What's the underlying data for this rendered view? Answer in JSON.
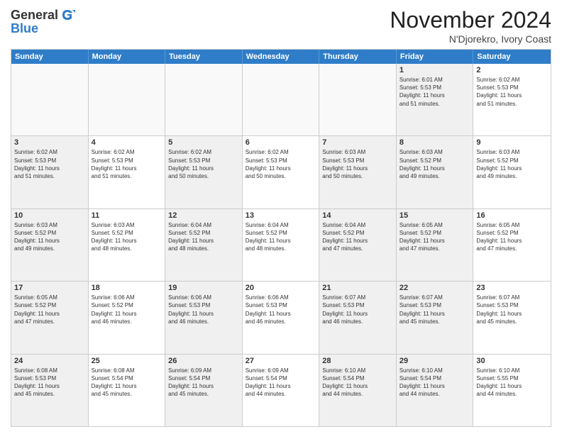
{
  "header": {
    "logo_line1": "General",
    "logo_line2": "Blue",
    "month_title": "November 2024",
    "location": "N'Djorekro, Ivory Coast"
  },
  "weekdays": [
    "Sunday",
    "Monday",
    "Tuesday",
    "Wednesday",
    "Thursday",
    "Friday",
    "Saturday"
  ],
  "rows": [
    [
      {
        "day": "",
        "info": "",
        "empty": true
      },
      {
        "day": "",
        "info": "",
        "empty": true
      },
      {
        "day": "",
        "info": "",
        "empty": true
      },
      {
        "day": "",
        "info": "",
        "empty": true
      },
      {
        "day": "",
        "info": "",
        "empty": true
      },
      {
        "day": "1",
        "info": "Sunrise: 6:01 AM\nSunset: 5:53 PM\nDaylight: 11 hours\nand 51 minutes.",
        "shaded": true
      },
      {
        "day": "2",
        "info": "Sunrise: 6:02 AM\nSunset: 5:53 PM\nDaylight: 11 hours\nand 51 minutes.",
        "shaded": false
      }
    ],
    [
      {
        "day": "3",
        "info": "Sunrise: 6:02 AM\nSunset: 5:53 PM\nDaylight: 11 hours\nand 51 minutes.",
        "shaded": true
      },
      {
        "day": "4",
        "info": "Sunrise: 6:02 AM\nSunset: 5:53 PM\nDaylight: 11 hours\nand 51 minutes."
      },
      {
        "day": "5",
        "info": "Sunrise: 6:02 AM\nSunset: 5:53 PM\nDaylight: 11 hours\nand 50 minutes.",
        "shaded": true
      },
      {
        "day": "6",
        "info": "Sunrise: 6:02 AM\nSunset: 5:53 PM\nDaylight: 11 hours\nand 50 minutes."
      },
      {
        "day": "7",
        "info": "Sunrise: 6:03 AM\nSunset: 5:53 PM\nDaylight: 11 hours\nand 50 minutes.",
        "shaded": true
      },
      {
        "day": "8",
        "info": "Sunrise: 6:03 AM\nSunset: 5:52 PM\nDaylight: 11 hours\nand 49 minutes.",
        "shaded": true
      },
      {
        "day": "9",
        "info": "Sunrise: 6:03 AM\nSunset: 5:52 PM\nDaylight: 11 hours\nand 49 minutes."
      }
    ],
    [
      {
        "day": "10",
        "info": "Sunrise: 6:03 AM\nSunset: 5:52 PM\nDaylight: 11 hours\nand 49 minutes.",
        "shaded": true
      },
      {
        "day": "11",
        "info": "Sunrise: 6:03 AM\nSunset: 5:52 PM\nDaylight: 11 hours\nand 48 minutes."
      },
      {
        "day": "12",
        "info": "Sunrise: 6:04 AM\nSunset: 5:52 PM\nDaylight: 11 hours\nand 48 minutes.",
        "shaded": true
      },
      {
        "day": "13",
        "info": "Sunrise: 6:04 AM\nSunset: 5:52 PM\nDaylight: 11 hours\nand 48 minutes."
      },
      {
        "day": "14",
        "info": "Sunrise: 6:04 AM\nSunset: 5:52 PM\nDaylight: 11 hours\nand 47 minutes.",
        "shaded": true
      },
      {
        "day": "15",
        "info": "Sunrise: 6:05 AM\nSunset: 5:52 PM\nDaylight: 11 hours\nand 47 minutes.",
        "shaded": true
      },
      {
        "day": "16",
        "info": "Sunrise: 6:05 AM\nSunset: 5:52 PM\nDaylight: 11 hours\nand 47 minutes."
      }
    ],
    [
      {
        "day": "17",
        "info": "Sunrise: 6:05 AM\nSunset: 5:52 PM\nDaylight: 11 hours\nand 47 minutes.",
        "shaded": true
      },
      {
        "day": "18",
        "info": "Sunrise: 6:06 AM\nSunset: 5:52 PM\nDaylight: 11 hours\nand 46 minutes."
      },
      {
        "day": "19",
        "info": "Sunrise: 6:06 AM\nSunset: 5:53 PM\nDaylight: 11 hours\nand 46 minutes.",
        "shaded": true
      },
      {
        "day": "20",
        "info": "Sunrise: 6:06 AM\nSunset: 5:53 PM\nDaylight: 11 hours\nand 46 minutes."
      },
      {
        "day": "21",
        "info": "Sunrise: 6:07 AM\nSunset: 5:53 PM\nDaylight: 11 hours\nand 46 minutes.",
        "shaded": true
      },
      {
        "day": "22",
        "info": "Sunrise: 6:07 AM\nSunset: 5:53 PM\nDaylight: 11 hours\nand 45 minutes.",
        "shaded": true
      },
      {
        "day": "23",
        "info": "Sunrise: 6:07 AM\nSunset: 5:53 PM\nDaylight: 11 hours\nand 45 minutes."
      }
    ],
    [
      {
        "day": "24",
        "info": "Sunrise: 6:08 AM\nSunset: 5:53 PM\nDaylight: 11 hours\nand 45 minutes.",
        "shaded": true
      },
      {
        "day": "25",
        "info": "Sunrise: 6:08 AM\nSunset: 5:54 PM\nDaylight: 11 hours\nand 45 minutes."
      },
      {
        "day": "26",
        "info": "Sunrise: 6:09 AM\nSunset: 5:54 PM\nDaylight: 11 hours\nand 45 minutes.",
        "shaded": true
      },
      {
        "day": "27",
        "info": "Sunrise: 6:09 AM\nSunset: 5:54 PM\nDaylight: 11 hours\nand 44 minutes."
      },
      {
        "day": "28",
        "info": "Sunrise: 6:10 AM\nSunset: 5:54 PM\nDaylight: 11 hours\nand 44 minutes.",
        "shaded": true
      },
      {
        "day": "29",
        "info": "Sunrise: 6:10 AM\nSunset: 5:54 PM\nDaylight: 11 hours\nand 44 minutes.",
        "shaded": true
      },
      {
        "day": "30",
        "info": "Sunrise: 6:10 AM\nSunset: 5:55 PM\nDaylight: 11 hours\nand 44 minutes."
      }
    ]
  ]
}
